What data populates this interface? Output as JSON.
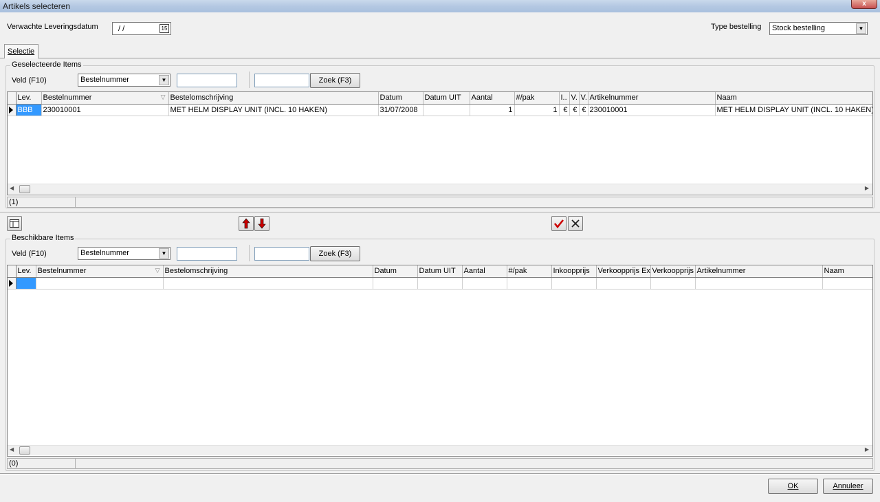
{
  "window": {
    "title": "Artikels selecteren",
    "close_label": "x"
  },
  "header": {
    "delivery_date_label": "Verwachte Leveringsdatum",
    "delivery_date_value": "/ /",
    "calendar_badge": "15",
    "order_type_label": "Type bestelling",
    "order_type_value": "Stock bestelling"
  },
  "tabs": [
    {
      "label": "Selectie"
    }
  ],
  "selected": {
    "legend": "Geselecteerde Items",
    "field_label": "Veld (F10)",
    "field_value": "Bestelnummer",
    "search_value": "",
    "search2_value": "",
    "search_button": "Zoek (F3)",
    "columns": [
      "Lev.",
      "Bestelnummer",
      "Bestelomschrijving",
      "Datum",
      "Datum UIT",
      "Aantal",
      "#/pak",
      "I..",
      "V.",
      "V.",
      "Artikelnummer",
      "Naam"
    ],
    "rows": [
      [
        "BBB",
        "230010001",
        "MET HELM DISPLAY UNIT (INCL. 10 HAKEN)",
        "31/07/2008",
        "",
        "1",
        "1",
        "€",
        "€",
        "€",
        "230010001",
        "MET HELM DISPLAY UNIT (INCL. 10 HAKEN)"
      ]
    ],
    "status": "(1)"
  },
  "toolbar": {
    "columns_icon": "columns-icon",
    "up_icon": "arrow-up-icon",
    "down_icon": "arrow-down-icon",
    "confirm_icon": "check-icon",
    "cancel_icon": "x-icon",
    "accent_red": "#cc0000"
  },
  "available": {
    "legend": "Beschikbare Items",
    "field_label": "Veld (F10)",
    "field_value": "Bestelnummer",
    "search_value": "",
    "search2_value": "",
    "search_button": "Zoek (F3)",
    "columns": [
      "Lev.",
      "Bestelnummer",
      "Bestelomschrijving",
      "Datum",
      "Datum UIT",
      "Aantal",
      "#/pak",
      "Inkoopprijs",
      "Verkoopprijs Ex",
      "Verkoopprijs",
      "Artikelnummer",
      "Naam"
    ],
    "status": "(0)"
  },
  "footer": {
    "ok_label": "OK",
    "cancel_label": "Annuleer"
  }
}
